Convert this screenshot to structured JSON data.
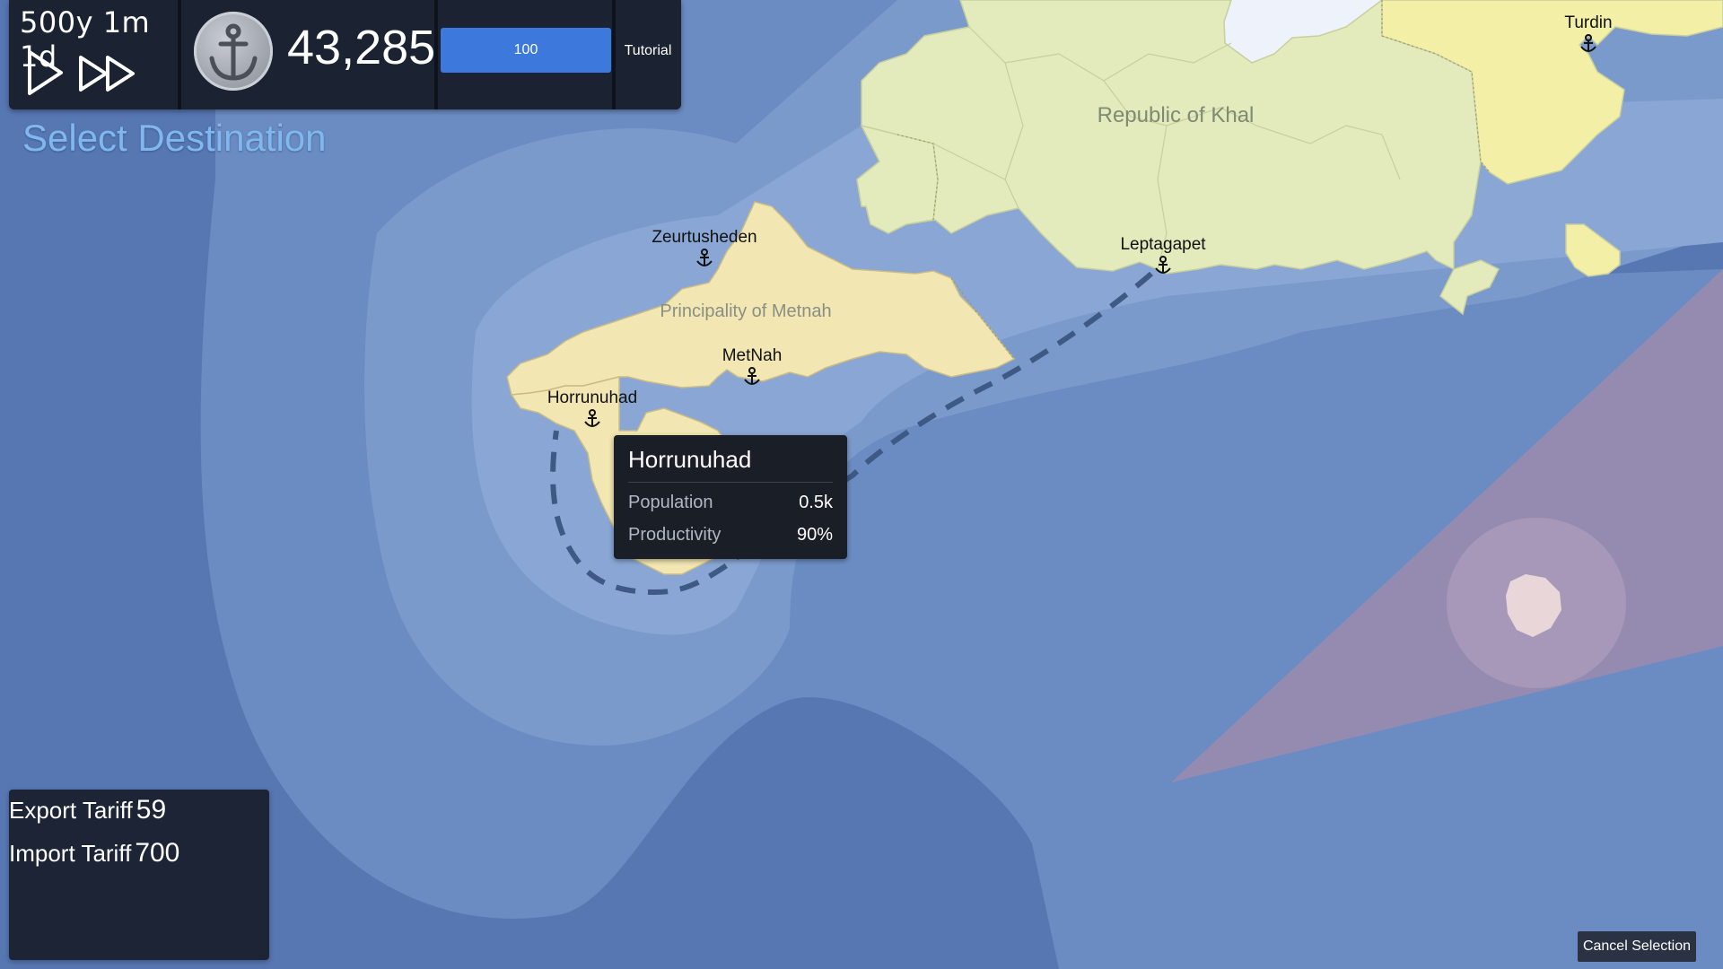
{
  "top_bar": {
    "date": "500y 1m 1d",
    "play_icon": "play-icon",
    "fast_forward_icon": "fast-forward-icon",
    "emblem_icon": "anchor-icon",
    "money": "43,285",
    "progress_value": "100",
    "progress_fraction": 1.0,
    "tutorial_label": "Tutorial"
  },
  "mode_title": "Select Destination",
  "map": {
    "countries": [
      {
        "name": "Republic of Khal",
        "color": "#e3eabb"
      },
      {
        "name": "Principality of Metnah",
        "color": "#f2e6b2"
      }
    ],
    "ports": [
      "Zeurtusheden",
      "Leptagapet",
      "Turdin",
      "MetNah",
      "Horrunuhad"
    ],
    "port_icon": "anchor-icon",
    "route_style": "dashed",
    "sea_color": "#5a7fb8"
  },
  "tooltip": {
    "title": "Horrunuhad",
    "rows": [
      {
        "label": "Population",
        "value": "0.5k"
      },
      {
        "label": "Productivity",
        "value": "90%"
      }
    ]
  },
  "tariffs": {
    "export_label": "Export Tariff",
    "export_value": "59",
    "import_label": "Import Tariff",
    "import_value": "700"
  },
  "cancel_label": "Cancel Selection"
}
